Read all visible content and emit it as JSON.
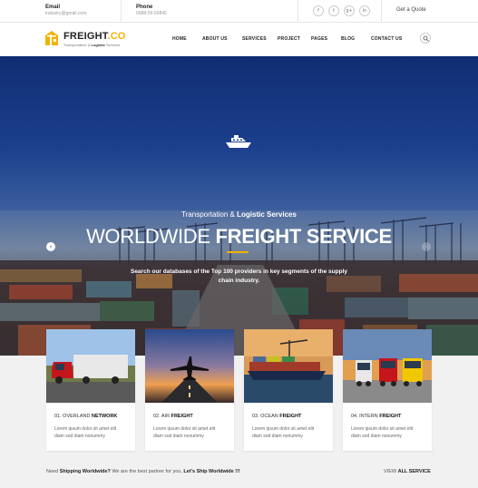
{
  "topbar": {
    "email_label": "Email",
    "email_value": "industry@gmail.com",
    "phone_label": "Phone",
    "phone_value": "0088-55-69845",
    "social": [
      {
        "icon": "facebook-icon",
        "glyph": "f"
      },
      {
        "icon": "twitter-icon",
        "glyph": "t"
      },
      {
        "icon": "google-plus-icon",
        "glyph": "g+"
      },
      {
        "icon": "linkedin-icon",
        "glyph": "in"
      }
    ],
    "quote_label": "Get a Quote"
  },
  "header": {
    "logo_main": "FREIGHT",
    "logo_suffix": ".CO",
    "logo_sub_a": "Transportation & ",
    "logo_sub_b": "Logistic",
    "logo_sub_c": " Services",
    "nav": [
      "HOME",
      "ABOUT US",
      "SERVICES",
      "PROJECT",
      "PAGES",
      "BLOG",
      "CONTACT US"
    ],
    "search_icon": "search-icon"
  },
  "hero": {
    "subtitle_a": "Transportation & ",
    "subtitle_b": "Logistic Services",
    "title_a": "WORLDWIDE ",
    "title_b": "FREIGHT SERVICE",
    "description": "Search our databases of the Top 100 providers in key segments of the supply chain industry.",
    "prev_glyph": "‹",
    "next_glyph": "›",
    "slide_count": 3,
    "active_slide": 2
  },
  "services": [
    {
      "num": "01. OVERLAND ",
      "name": "NETWORK",
      "desc": "Lorem ipsum dolor sit amet elit diam sod diam nonummy",
      "image": "truck"
    },
    {
      "num": "02. AIR ",
      "name": "FREIGHT",
      "desc": "Lorem ipsum dolor sit amet elit diam sod diam nonummy",
      "image": "airplane"
    },
    {
      "num": "03. OCEAN ",
      "name": "FREIGHT",
      "desc": "Lorem ipsum dolor sit amet elit diam sod diam nonummy",
      "image": "ship"
    },
    {
      "num": "04. INTERN ",
      "name": "FREIGHT",
      "desc": "Lorem ipsum dolor sit amet elit diam sod diam nonummy",
      "image": "trucks"
    }
  ],
  "footer": {
    "text_a": "Need ",
    "text_b": "Shipping Worldwide?",
    "text_c": " We are the best partner for you, ",
    "text_d": "Let's Ship Worldwide !!!",
    "link_a": "VIEW ",
    "link_b": "ALL SERVICE"
  },
  "colors": {
    "accent": "#f0b400",
    "hero_blue": "#1c3f8c"
  }
}
